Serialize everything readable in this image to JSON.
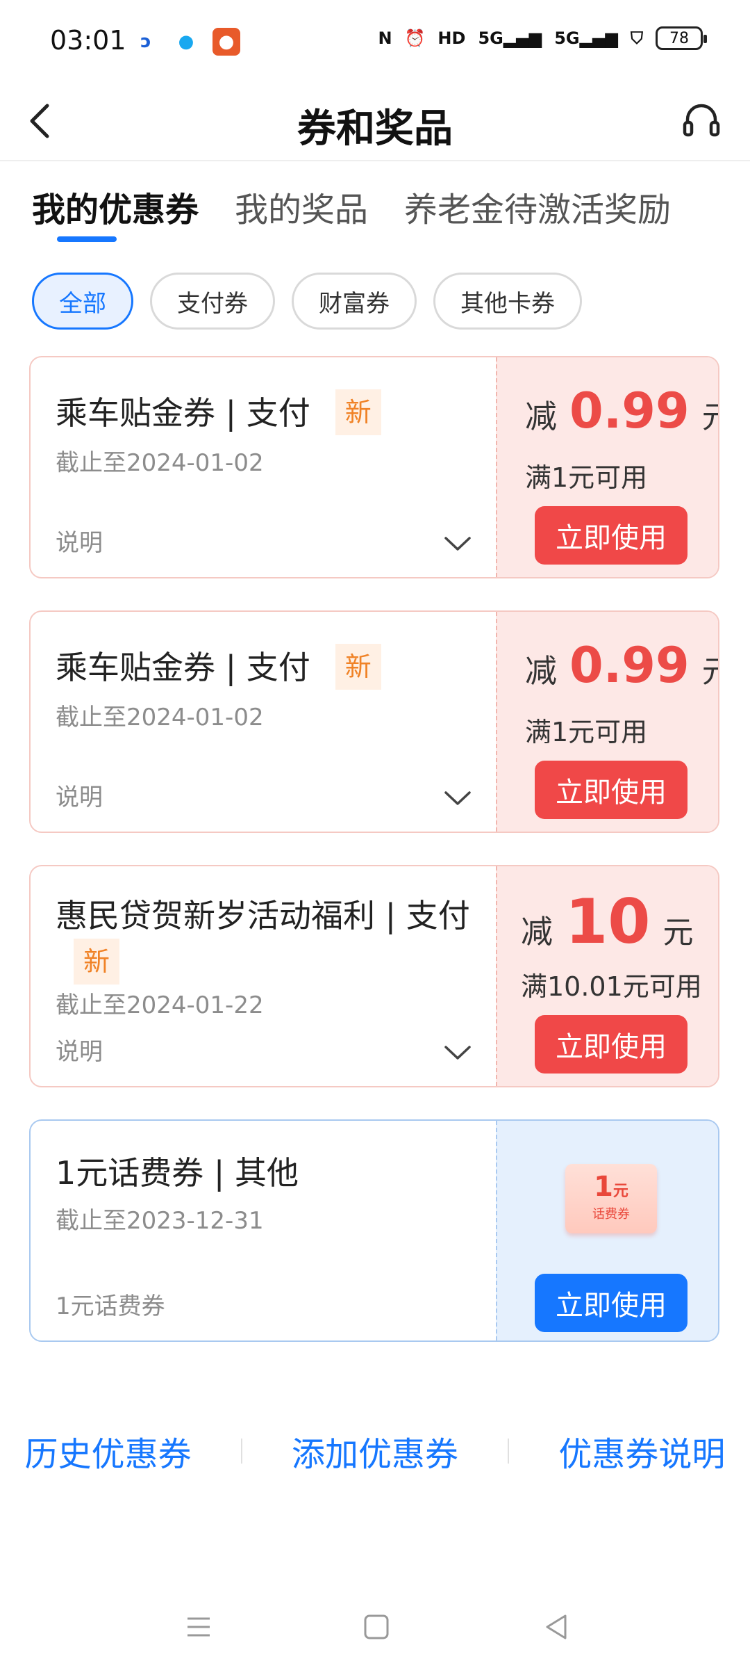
{
  "status_bar": {
    "time": "03:01",
    "battery": "78",
    "icons": [
      "nfc-icon",
      "alarm-icon",
      "hd-icon",
      "signal-5g-icon",
      "signal-5g-icon",
      "shield-icon",
      "battery-icon"
    ]
  },
  "header": {
    "title": "券和奖品"
  },
  "tabs": [
    {
      "label": "我的优惠券",
      "active": true
    },
    {
      "label": "我的奖品",
      "active": false
    },
    {
      "label": "养老金待激活奖励",
      "active": false
    }
  ],
  "filters": [
    {
      "label": "全部",
      "active": true
    },
    {
      "label": "支付券",
      "active": false
    },
    {
      "label": "财富券",
      "active": false
    },
    {
      "label": "其他卡券",
      "active": false
    }
  ],
  "coupons": [
    {
      "name": "乘车贴金券 | 支付",
      "badge": "新",
      "date": "截止至2024-01-02",
      "desc": "说明",
      "prefix": "减",
      "amount": "0.99",
      "unit": "元",
      "condition": "满1元可用",
      "button": "立即使用"
    },
    {
      "name": "乘车贴金券 | 支付",
      "badge": "新",
      "date": "截止至2024-01-02",
      "desc": "说明",
      "prefix": "减",
      "amount": "0.99",
      "unit": "元",
      "condition": "满1元可用",
      "button": "立即使用"
    },
    {
      "name": "惠民贷贺新岁活动福利 | 支付",
      "badge": "新",
      "date": "截止至2024-01-22",
      "desc": "说明",
      "prefix": "减",
      "amount": "10",
      "unit": "元",
      "condition": "满10.01元可用",
      "button": "立即使用"
    },
    {
      "name": "1元话费券 | 其他",
      "date": "截止至2023-12-31",
      "desc": "1元话费券",
      "ticket_value": "1",
      "ticket_unit": "元",
      "ticket_label": "话费券",
      "button": "立即使用"
    }
  ],
  "footer_links": [
    "历史优惠券",
    "添加优惠券",
    "优惠券说明"
  ],
  "colors": {
    "accent": "#1677ff",
    "red": "#ec4b47",
    "new_badge": "#f08226"
  }
}
